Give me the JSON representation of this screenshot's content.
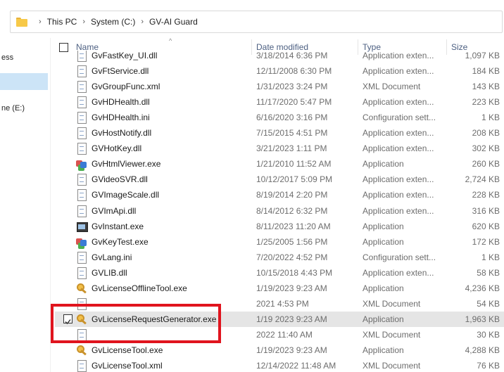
{
  "breadcrumb": {
    "items": [
      "This PC",
      "System (C:)",
      "GV-AI Guard"
    ]
  },
  "nav": {
    "items": [
      {
        "label": "ess",
        "selected": false
      },
      {
        "label": "",
        "selected": true
      },
      {
        "label": "ne (E:)",
        "selected": false
      }
    ]
  },
  "columns": {
    "name": "Name",
    "date": "Date modified",
    "type": "Type",
    "size": "Size"
  },
  "files": [
    {
      "name": "GvFastKey_UI.dll",
      "date": "3/18/2014 6:36 PM",
      "type": "Application exten...",
      "size": "1,097 KB",
      "icon": "dll-icon"
    },
    {
      "name": "GvFtService.dll",
      "date": "12/11/2008 6:30 PM",
      "type": "Application exten...",
      "size": "184 KB",
      "icon": "dll-icon"
    },
    {
      "name": "GvGroupFunc.xml",
      "date": "1/31/2023 3:24 PM",
      "type": "XML Document",
      "size": "143 KB",
      "icon": "xml-icon"
    },
    {
      "name": "GvHDHealth.dll",
      "date": "11/17/2020 5:47 PM",
      "type": "Application exten...",
      "size": "223 KB",
      "icon": "dll-icon"
    },
    {
      "name": "GvHDHealth.ini",
      "date": "6/16/2020 3:16 PM",
      "type": "Configuration sett...",
      "size": "1 KB",
      "icon": "ini-icon"
    },
    {
      "name": "GvHostNotify.dll",
      "date": "7/15/2015 4:51 PM",
      "type": "Application exten...",
      "size": "208 KB",
      "icon": "dll-icon"
    },
    {
      "name": "GVHotKey.dll",
      "date": "3/21/2023 1:11 PM",
      "type": "Application exten...",
      "size": "302 KB",
      "icon": "dll-icon"
    },
    {
      "name": "GvHtmlViewer.exe",
      "date": "1/21/2010 11:52 AM",
      "type": "Application",
      "size": "260 KB",
      "icon": "app-icon"
    },
    {
      "name": "GVideoSVR.dll",
      "date": "10/12/2017 5:09 PM",
      "type": "Application exten...",
      "size": "2,724 KB",
      "icon": "dll-icon"
    },
    {
      "name": "GVImageScale.dll",
      "date": "8/19/2014 2:20 PM",
      "type": "Application exten...",
      "size": "228 KB",
      "icon": "dll-icon"
    },
    {
      "name": "GVImApi.dll",
      "date": "8/14/2012 6:32 PM",
      "type": "Application exten...",
      "size": "316 KB",
      "icon": "dll-icon"
    },
    {
      "name": "GvInstant.exe",
      "date": "8/11/2023 11:20 AM",
      "type": "Application",
      "size": "620 KB",
      "icon": "window-icon"
    },
    {
      "name": "GvKeyTest.exe",
      "date": "1/25/2005 1:56 PM",
      "type": "Application",
      "size": "172 KB",
      "icon": "app-icon"
    },
    {
      "name": "GvLang.ini",
      "date": "7/20/2022 4:52 PM",
      "type": "Configuration sett...",
      "size": "1 KB",
      "icon": "ini-icon"
    },
    {
      "name": "GVLIB.dll",
      "date": "10/15/2018 4:43 PM",
      "type": "Application exten...",
      "size": "58 KB",
      "icon": "dll-icon"
    },
    {
      "name": "GvLicenseOfflineTool.exe",
      "date": "1/19/2023 9:23 AM",
      "type": "Application",
      "size": "4,236 KB",
      "icon": "key-icon"
    },
    {
      "name": "",
      "date": "2021 4:53 PM",
      "type": "XML Document",
      "size": "54 KB",
      "icon": "xml-icon"
    },
    {
      "name": "GvLicenseRequestGenerator.exe",
      "date": "1/19 2023 9:23 AM",
      "type": "Application",
      "size": "1,963 KB",
      "icon": "key-icon",
      "selected": true
    },
    {
      "name": "",
      "date": "2022 11:40 AM",
      "type": "XML Document",
      "size": "30 KB",
      "icon": "xml-icon"
    },
    {
      "name": "GvLicenseTool.exe",
      "date": "1/19/2023 9:23 AM",
      "type": "Application",
      "size": "4,288 KB",
      "icon": "key-icon"
    },
    {
      "name": "GvLicenseTool.xml",
      "date": "12/14/2022 11:48 AM",
      "type": "XML Document",
      "size": "76 KB",
      "icon": "xml-icon"
    }
  ],
  "colors": {
    "selection": "#e5e5e5",
    "nav_selection": "#cce4f7",
    "highlight_box": "#e0141e",
    "header_text": "#4d6082"
  }
}
